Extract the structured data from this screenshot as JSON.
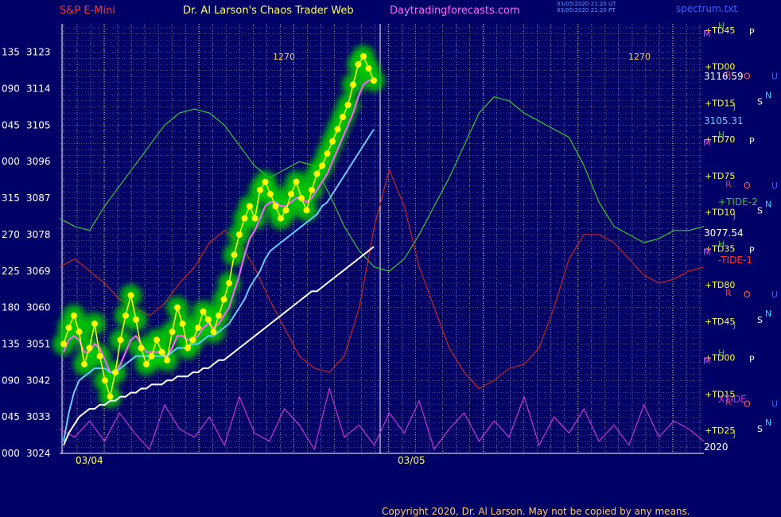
{
  "header": {
    "instrument": "S&P E-Mini",
    "site": "Dr. Al Larson's Chaos Trader Web",
    "link": "Daytradingforecasts.com",
    "spectrum": "spectrum.txt",
    "stamp1": "03/05/2020 21:20 UT",
    "stamp2": "03/05/2020 21:20 PT"
  },
  "footer": {
    "copyright": "Copyright 2020, Dr. Al Larson. May not be copied by any means."
  },
  "colors": {
    "background": "#000066",
    "price_bars": "#ffff00",
    "glow": "#00cc00",
    "ema_fast": "#ff66ff",
    "ema_mid": "#66ccff",
    "ema_slow": "#ffffff",
    "tide2": "#33cc33",
    "tide1": "#cc2222",
    "xtide": "#cc33cc"
  },
  "chart_data": {
    "type": "line",
    "title": "S&P E-Mini",
    "x_date_labels": [
      "03/04",
      "03/05"
    ],
    "ylim": [
      3024,
      3130
    ],
    "y_ticks": [
      {
        "angle": "000",
        "price": 3024
      },
      {
        "angle": "045",
        "price": 3033
      },
      {
        "angle": "090",
        "price": 3042
      },
      {
        "angle": "135",
        "price": 3051
      },
      {
        "angle": "180",
        "price": 3060
      },
      {
        "angle": "225",
        "price": 3069
      },
      {
        "angle": "270",
        "price": 3078
      },
      {
        "angle": "315",
        "price": 3087
      },
      {
        "angle": "000",
        "price": 3096
      },
      {
        "angle": "045",
        "price": 3105
      },
      {
        "angle": "090",
        "price": 3114
      },
      {
        "angle": "135",
        "price": 3123
      }
    ],
    "price_labels": [
      "3116.59",
      "3105.31",
      "3077.54"
    ],
    "tide_labels": [
      "+TIDE-2",
      "-TIDE-1",
      "XTIDE"
    ],
    "year_label": "2020",
    "cycle_labels": [
      "1270",
      "1270"
    ],
    "grid_labels": [
      "+TD45",
      "+TD00",
      "+TD15",
      "+TD70",
      "+TD75",
      "+TD10",
      "+TD35",
      "+TD80",
      "+TD45",
      "+TD00",
      "+TD15",
      "+TD25"
    ],
    "right_symbols": [
      "H",
      "J",
      "R",
      "M",
      "N",
      "U",
      "P",
      "S",
      "O"
    ],
    "price_series": [
      {
        "name": "price",
        "values": [
          3051,
          3055,
          3058,
          3054,
          3046,
          3050,
          3056,
          3048,
          3042,
          3038,
          3044,
          3052,
          3058,
          3063,
          3057,
          3050,
          3046,
          3048,
          3052,
          3049,
          3047,
          3054,
          3060,
          3056,
          3050,
          3052,
          3055,
          3059,
          3057,
          3054,
          3058,
          3062,
          3066,
          3073,
          3078,
          3082,
          3085,
          3082,
          3089,
          3091,
          3088,
          3085,
          3082,
          3084,
          3088,
          3091,
          3087,
          3084,
          3089,
          3093,
          3095,
          3098,
          3101,
          3104,
          3107,
          3110,
          3115,
          3120,
          3122,
          3119,
          3116
        ]
      }
    ],
    "ema_series": [
      {
        "name": "fast",
        "values": [
          3049,
          3052,
          3053,
          3052,
          3049,
          3049,
          3051,
          3050,
          3047,
          3044,
          3044,
          3046,
          3049,
          3052,
          3053,
          3051,
          3049,
          3049,
          3049,
          3049,
          3048,
          3050,
          3053,
          3053,
          3052,
          3052,
          3053,
          3055,
          3056,
          3055,
          3056,
          3058,
          3060,
          3064,
          3068,
          3073,
          3077,
          3079,
          3082,
          3085,
          3086,
          3086,
          3085,
          3085,
          3086,
          3087,
          3087,
          3086,
          3087,
          3089,
          3091,
          3093,
          3096,
          3099,
          3102,
          3105,
          3108,
          3112,
          3115,
          3116,
          3116
        ]
      },
      {
        "name": "mid",
        "values": [
          3027,
          3034,
          3039,
          3042,
          3043,
          3044,
          3045,
          3045,
          3045,
          3044,
          3044,
          3045,
          3046,
          3047,
          3048,
          3048,
          3048,
          3048,
          3048,
          3048,
          3048,
          3049,
          3050,
          3050,
          3050,
          3051,
          3051,
          3052,
          3053,
          3053,
          3054,
          3055,
          3056,
          3058,
          3060,
          3062,
          3065,
          3067,
          3069,
          3072,
          3074,
          3075,
          3076,
          3077,
          3078,
          3079,
          3080,
          3081,
          3082,
          3083,
          3085,
          3086,
          3088,
          3090,
          3092,
          3094,
          3096,
          3098,
          3100,
          3102,
          3104
        ]
      },
      {
        "name": "slow",
        "values": [
          3026,
          3029,
          3031,
          3033,
          3034,
          3035,
          3035,
          3036,
          3036,
          3037,
          3037,
          3038,
          3038,
          3039,
          3039,
          3040,
          3040,
          3041,
          3041,
          3041,
          3042,
          3042,
          3043,
          3043,
          3043,
          3044,
          3044,
          3045,
          3045,
          3046,
          3047,
          3047,
          3048,
          3049,
          3050,
          3051,
          3052,
          3053,
          3054,
          3055,
          3056,
          3057,
          3058,
          3059,
          3060,
          3061,
          3062,
          3063,
          3064,
          3064,
          3065,
          3066,
          3067,
          3068,
          3069,
          3070,
          3071,
          3072,
          3073,
          3074,
          3075
        ]
      }
    ],
    "forecast_series": [
      {
        "name": "+TIDE-2",
        "values": [
          3082,
          3080,
          3079,
          3085,
          3090,
          3095,
          3100,
          3105,
          3108,
          3109,
          3108,
          3105,
          3100,
          3095,
          3092,
          3094,
          3096,
          3095,
          3088,
          3080,
          3074,
          3070,
          3069,
          3072,
          3078,
          3085,
          3092,
          3100,
          3108,
          3112,
          3111,
          3108,
          3106,
          3104,
          3102,
          3095,
          3086,
          3080,
          3078,
          3076,
          3077,
          3079,
          3079,
          3080
        ]
      },
      {
        "name": "-TIDE-1",
        "values": [
          3070,
          3072,
          3069,
          3066,
          3062,
          3060,
          3058,
          3061,
          3066,
          3070,
          3076,
          3079,
          3076,
          3070,
          3062,
          3055,
          3048,
          3045,
          3044,
          3048,
          3060,
          3080,
          3094,
          3085,
          3070,
          3060,
          3050,
          3044,
          3040,
          3042,
          3045,
          3046,
          3050,
          3060,
          3072,
          3078,
          3078,
          3076,
          3072,
          3068,
          3066,
          3067,
          3069,
          3070
        ]
      },
      {
        "name": "XTIDE",
        "values": [
          3030,
          3028,
          3032,
          3027,
          3034,
          3029,
          3025,
          3036,
          3030,
          3028,
          3033,
          3026,
          3038,
          3029,
          3027,
          3035,
          3031,
          3025,
          3040,
          3028,
          3031,
          3026,
          3034,
          3029,
          3037,
          3025,
          3030,
          3034,
          3027,
          3032,
          3028,
          3038,
          3026,
          3033,
          3029,
          3035,
          3027,
          3031,
          3026,
          3036,
          3028,
          3032,
          3030,
          3027
        ]
      }
    ]
  }
}
